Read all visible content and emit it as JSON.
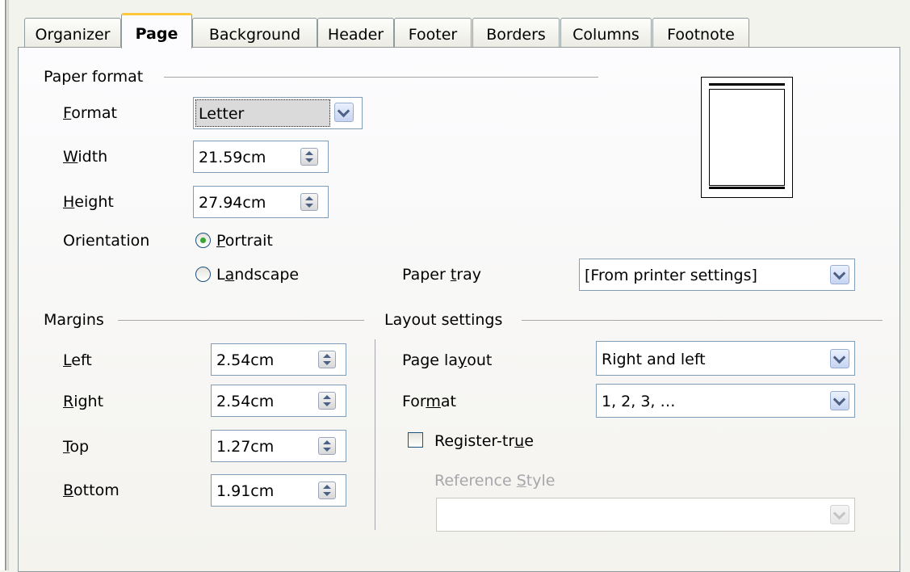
{
  "tabs": [
    {
      "label": "Organizer"
    },
    {
      "label": "Page"
    },
    {
      "label": "Background"
    },
    {
      "label": "Header"
    },
    {
      "label": "Footer"
    },
    {
      "label": "Borders"
    },
    {
      "label": "Columns"
    },
    {
      "label": "Footnote"
    }
  ],
  "active_tab": "Page",
  "paper_format": {
    "section_label": "Paper format",
    "format": {
      "label_key": "F",
      "label_rest": "ormat",
      "value": "Letter"
    },
    "width": {
      "label_key": "W",
      "label_rest": "idth",
      "value": "21.59cm"
    },
    "height": {
      "label_key": "H",
      "label_rest": "eight",
      "value": "27.94cm"
    },
    "orientation": {
      "label": "Orientation",
      "portrait_key": "P",
      "portrait_rest": "ortrait",
      "landscape_pre": "L",
      "landscape_key": "a",
      "landscape_rest": "ndscape",
      "selected": "Portrait"
    },
    "paper_tray": {
      "label_pre": "Paper ",
      "label_key": "t",
      "label_rest": "ray",
      "value": "[From printer settings]"
    }
  },
  "margins": {
    "section_label": "Margins",
    "left": {
      "label_key": "L",
      "label_rest": "eft",
      "value": "2.54cm"
    },
    "right": {
      "label_key": "R",
      "label_rest": "ight",
      "value": "2.54cm"
    },
    "top": {
      "label_key": "T",
      "label_rest": "op",
      "value": "1.27cm"
    },
    "bottom": {
      "label_key": "B",
      "label_rest": "ottom",
      "value": "1.91cm"
    }
  },
  "layout_settings": {
    "section_label": "Layout settings",
    "page_layout": {
      "label_pre": "Page la",
      "label_key": "y",
      "label_rest": "out",
      "value": "Right and left"
    },
    "format": {
      "label_pre": "For",
      "label_key": "m",
      "label_rest": "at",
      "value": "1, 2, 3, …"
    },
    "register_true": {
      "label_pre": "Register-tr",
      "label_key": "u",
      "label_rest": "e",
      "checked": false
    },
    "reference_style": {
      "label_pre": "Reference ",
      "label_key": "S",
      "label_rest": "tyle",
      "value": "",
      "disabled": true
    }
  },
  "colors": {
    "active_tab_accent": "#ffc73c",
    "radio_selected": "#3ca436",
    "field_border": "#7f9db9"
  },
  "icons": [
    "spin-button-icon",
    "dropdown-chevron-icon",
    "radio-icon",
    "checkbox-icon",
    "page-preview-icon"
  ]
}
